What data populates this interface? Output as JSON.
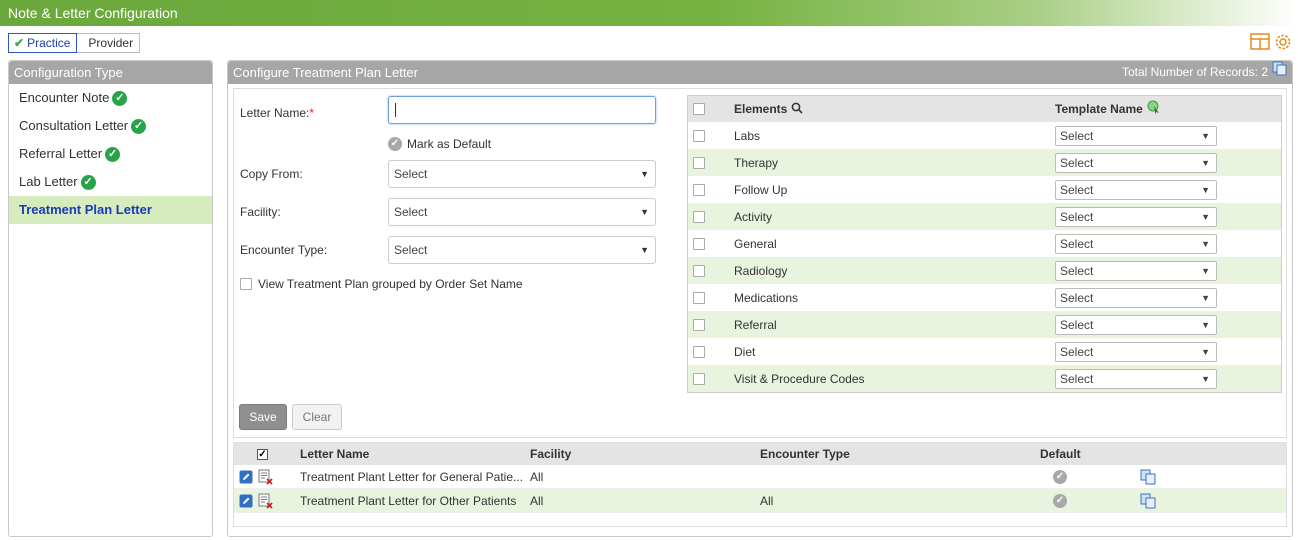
{
  "app": {
    "title": "Note & Letter Configuration"
  },
  "toggle": {
    "practice": "Practice",
    "provider": "Provider"
  },
  "left": {
    "header": "Configuration Type",
    "items": [
      {
        "label": "Encounter Note",
        "configured": true
      },
      {
        "label": "Consultation Letter",
        "configured": true
      },
      {
        "label": "Referral Letter",
        "configured": true
      },
      {
        "label": "Lab Letter",
        "configured": true
      },
      {
        "label": "Treatment Plan Letter",
        "configured": false
      }
    ]
  },
  "main": {
    "header": "Configure Treatment Plan Letter",
    "records_label": "Total Number of Records: 2"
  },
  "form": {
    "letter_name_label": "Letter Name:",
    "required_marker": "*",
    "letter_name_value": "",
    "mark_default_label": "Mark as Default",
    "copy_from_label": "Copy From:",
    "copy_from_value": "Select",
    "facility_label": "Facility:",
    "facility_value": "Select",
    "encounter_type_label": "Encounter Type:",
    "encounter_type_value": "Select",
    "view_grouped_label": "View Treatment Plan grouped by Order Set Name"
  },
  "elements": {
    "col_elements": "Elements",
    "col_template": "Template Name",
    "rows": [
      {
        "name": "Labs",
        "template": "Select"
      },
      {
        "name": "Therapy",
        "template": "Select"
      },
      {
        "name": "Follow Up",
        "template": "Select"
      },
      {
        "name": "Activity",
        "template": "Select"
      },
      {
        "name": "General",
        "template": "Select"
      },
      {
        "name": "Radiology",
        "template": "Select"
      },
      {
        "name": "Medications",
        "template": "Select"
      },
      {
        "name": "Referral",
        "template": "Select"
      },
      {
        "name": "Diet",
        "template": "Select"
      },
      {
        "name": "Visit & Procedure Codes",
        "template": "Select"
      }
    ]
  },
  "buttons": {
    "save": "Save",
    "clear": "Clear"
  },
  "grid": {
    "columns": {
      "letter_name": "Letter Name",
      "facility": "Facility",
      "encounter_type": "Encounter Type",
      "default": "Default"
    },
    "rows": [
      {
        "letter_name": "Treatment Plant Letter for General Patie...",
        "facility": "All",
        "encounter_type": ""
      },
      {
        "letter_name": "Treatment Plant Letter for Other Patients",
        "facility": "All",
        "encounter_type": "All"
      }
    ]
  },
  "colors": {
    "accent_green": "#76b241",
    "header_gray": "#a6a6a6",
    "active_row": "#d6ecbe",
    "link_blue": "#1a3bb5"
  }
}
